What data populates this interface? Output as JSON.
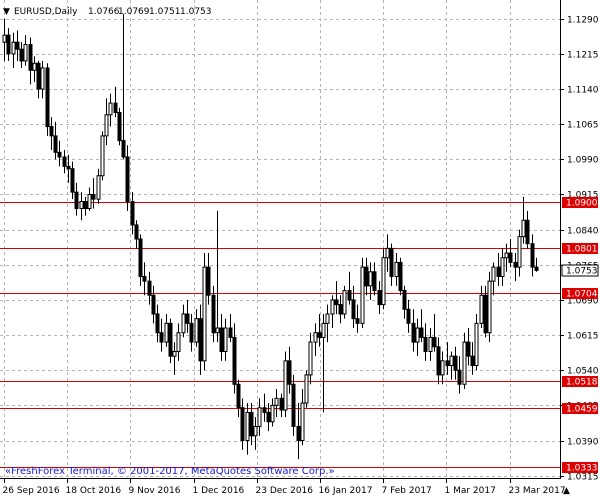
{
  "header": {
    "symbol_label": "EURUSD,Daily",
    "ohlc_values": [
      "1.0766",
      "1.0769",
      "1.0751",
      "1.0753"
    ]
  },
  "footer": {
    "copyright": "«FreshForex Terminal, © 2001-2017, MetaQuotes Software Corp.»"
  },
  "colors": {
    "background": "#ffffff",
    "grid": "#b4b4b4",
    "candle_line": "#000000",
    "bull_body": "#ffffff",
    "bear_body": "#000000",
    "level_line": "#dd0000",
    "level_label_bg": "#dd0000",
    "current_price_label_bg": "#ffffff",
    "copyright_text": "#1a1acc"
  },
  "chart_data": {
    "type": "candlestick",
    "title": "EURUSD,Daily",
    "y_axis_ticks": [
      "1.1290",
      "1.1215",
      "1.1140",
      "1.1065",
      "1.0990",
      "1.0915",
      "1.0840",
      "1.0765",
      "1.0690",
      "1.0615",
      "1.0540",
      "1.0465",
      "1.0390",
      "1.0315"
    ],
    "y_tick_values": [
      1.129,
      1.1215,
      1.114,
      1.1065,
      1.099,
      1.0915,
      1.084,
      1.0765,
      1.069,
      1.0615,
      1.054,
      1.0465,
      1.039,
      1.0315
    ],
    "x_axis_labels": [
      "26 Sep 2016",
      "18 Oct 2016",
      "9 Nov 2016",
      "1 Dec 2016",
      "23 Dec 2016",
      "16 Jan 2017",
      "7 Feb 2017",
      "1 Mar 2017",
      "23 Mar 2017"
    ],
    "ylim": [
      1.031,
      1.133
    ],
    "levels": [
      {
        "label": "1.0900",
        "value": 1.09
      },
      {
        "label": "1.0801",
        "value": 1.0801
      },
      {
        "label": "1.0704",
        "value": 1.0704
      },
      {
        "label": "1.0518",
        "value": 1.0518
      },
      {
        "label": "1.0459",
        "value": 1.0459
      },
      {
        "label": "1.0333",
        "value": 1.0333
      }
    ],
    "current_price": {
      "label": "1.0753",
      "value": 1.0753
    },
    "candles": [
      {
        "o": 1.124,
        "h": 1.129,
        "l": 1.12,
        "c": 1.1255
      },
      {
        "o": 1.1255,
        "h": 1.127,
        "l": 1.12,
        "c": 1.1215
      },
      {
        "o": 1.1215,
        "h": 1.126,
        "l": 1.1185,
        "c": 1.124
      },
      {
        "o": 1.124,
        "h": 1.1265,
        "l": 1.12,
        "c": 1.1225
      },
      {
        "o": 1.1225,
        "h": 1.124,
        "l": 1.1185,
        "c": 1.12
      },
      {
        "o": 1.12,
        "h": 1.1255,
        "l": 1.119,
        "c": 1.1235
      },
      {
        "o": 1.1235,
        "h": 1.125,
        "l": 1.115,
        "c": 1.118
      },
      {
        "o": 1.118,
        "h": 1.121,
        "l": 1.1155,
        "c": 1.1195
      },
      {
        "o": 1.1195,
        "h": 1.12,
        "l": 1.112,
        "c": 1.114
      },
      {
        "o": 1.114,
        "h": 1.12,
        "l": 1.112,
        "c": 1.1185
      },
      {
        "o": 1.1185,
        "h": 1.1195,
        "l": 1.104,
        "c": 1.106
      },
      {
        "o": 1.106,
        "h": 1.108,
        "l": 1.101,
        "c": 1.104
      },
      {
        "o": 1.104,
        "h": 1.107,
        "l": 1.099,
        "c": 1.1005
      },
      {
        "o": 1.1005,
        "h": 1.103,
        "l": 1.0975,
        "c": 1.0995
      },
      {
        "o": 1.0995,
        "h": 1.101,
        "l": 1.096,
        "c": 1.0975
      },
      {
        "o": 1.0975,
        "h": 1.1,
        "l": 1.094,
        "c": 1.097
      },
      {
        "o": 1.097,
        "h": 1.0985,
        "l": 1.0905,
        "c": 1.092
      },
      {
        "o": 1.092,
        "h": 1.094,
        "l": 1.087,
        "c": 1.0885
      },
      {
        "o": 1.0885,
        "h": 1.092,
        "l": 1.086,
        "c": 1.09
      },
      {
        "o": 1.09,
        "h": 1.091,
        "l": 1.087,
        "c": 1.0885
      },
      {
        "o": 1.0885,
        "h": 1.093,
        "l": 1.088,
        "c": 1.0915
      },
      {
        "o": 1.0915,
        "h": 1.095,
        "l": 1.0885,
        "c": 1.0905
      },
      {
        "o": 1.0905,
        "h": 1.097,
        "l": 1.0895,
        "c": 1.0955
      },
      {
        "o": 1.0955,
        "h": 1.105,
        "l": 1.0945,
        "c": 1.104
      },
      {
        "o": 1.104,
        "h": 1.112,
        "l": 1.102,
        "c": 1.1085
      },
      {
        "o": 1.1085,
        "h": 1.113,
        "l": 1.106,
        "c": 1.111
      },
      {
        "o": 1.111,
        "h": 1.1145,
        "l": 1.108,
        "c": 1.109
      },
      {
        "o": 1.109,
        "h": 1.11,
        "l": 1.102,
        "c": 1.103
      },
      {
        "o": 1.103,
        "h": 1.13,
        "l": 1.099,
        "c": 1.0995
      },
      {
        "o": 1.0995,
        "h": 1.102,
        "l": 1.088,
        "c": 1.09
      },
      {
        "o": 1.09,
        "h": 1.092,
        "l": 1.083,
        "c": 1.085
      },
      {
        "o": 1.085,
        "h": 1.086,
        "l": 1.08,
        "c": 1.082
      },
      {
        "o": 1.082,
        "h": 1.083,
        "l": 1.072,
        "c": 1.074
      },
      {
        "o": 1.074,
        "h": 1.077,
        "l": 1.07,
        "c": 1.073
      },
      {
        "o": 1.073,
        "h": 1.075,
        "l": 1.068,
        "c": 1.07
      },
      {
        "o": 1.07,
        "h": 1.072,
        "l": 1.064,
        "c": 1.066
      },
      {
        "o": 1.066,
        "h": 1.068,
        "l": 1.06,
        "c": 1.062
      },
      {
        "o": 1.062,
        "h": 1.065,
        "l": 1.058,
        "c": 1.06
      },
      {
        "o": 1.06,
        "h": 1.066,
        "l": 1.059,
        "c": 1.064
      },
      {
        "o": 1.064,
        "h": 1.065,
        "l": 1.0555,
        "c": 1.057
      },
      {
        "o": 1.057,
        "h": 1.06,
        "l": 1.053,
        "c": 1.058
      },
      {
        "o": 1.058,
        "h": 1.064,
        "l": 1.056,
        "c": 1.062
      },
      {
        "o": 1.062,
        "h": 1.068,
        "l": 1.061,
        "c": 1.066
      },
      {
        "o": 1.066,
        "h": 1.069,
        "l": 1.062,
        "c": 1.064
      },
      {
        "o": 1.064,
        "h": 1.066,
        "l": 1.058,
        "c": 1.06
      },
      {
        "o": 1.06,
        "h": 1.067,
        "l": 1.059,
        "c": 1.065
      },
      {
        "o": 1.065,
        "h": 1.068,
        "l": 1.053,
        "c": 1.056
      },
      {
        "o": 1.056,
        "h": 1.079,
        "l": 1.054,
        "c": 1.076
      },
      {
        "o": 1.076,
        "h": 1.079,
        "l": 1.068,
        "c": 1.07
      },
      {
        "o": 1.07,
        "h": 1.072,
        "l": 1.06,
        "c": 1.062
      },
      {
        "o": 1.062,
        "h": 1.088,
        "l": 1.06,
        "c": 1.063
      },
      {
        "o": 1.063,
        "h": 1.066,
        "l": 1.056,
        "c": 1.058
      },
      {
        "o": 1.058,
        "h": 1.065,
        "l": 1.056,
        "c": 1.063
      },
      {
        "o": 1.063,
        "h": 1.066,
        "l": 1.06,
        "c": 1.061
      },
      {
        "o": 1.061,
        "h": 1.064,
        "l": 1.049,
        "c": 1.051
      },
      {
        "o": 1.051,
        "h": 1.052,
        "l": 1.044,
        "c": 1.046
      },
      {
        "o": 1.046,
        "h": 1.048,
        "l": 1.037,
        "c": 1.039
      },
      {
        "o": 1.039,
        "h": 1.047,
        "l": 1.036,
        "c": 1.045
      },
      {
        "o": 1.045,
        "h": 1.047,
        "l": 1.038,
        "c": 1.04
      },
      {
        "o": 1.04,
        "h": 1.044,
        "l": 1.037,
        "c": 1.042
      },
      {
        "o": 1.042,
        "h": 1.048,
        "l": 1.04,
        "c": 1.046
      },
      {
        "o": 1.046,
        "h": 1.049,
        "l": 1.043,
        "c": 1.045
      },
      {
        "o": 1.045,
        "h": 1.047,
        "l": 1.041,
        "c": 1.043
      },
      {
        "o": 1.043,
        "h": 1.048,
        "l": 1.042,
        "c": 1.0465
      },
      {
        "o": 1.0465,
        "h": 1.05,
        "l": 1.044,
        "c": 1.048
      },
      {
        "o": 1.048,
        "h": 1.049,
        "l": 1.044,
        "c": 1.0455
      },
      {
        "o": 1.0455,
        "h": 1.058,
        "l": 1.044,
        "c": 1.056
      },
      {
        "o": 1.056,
        "h": 1.059,
        "l": 1.049,
        "c": 1.051
      },
      {
        "o": 1.051,
        "h": 1.053,
        "l": 1.04,
        "c": 1.042
      },
      {
        "o": 1.042,
        "h": 1.047,
        "l": 1.035,
        "c": 1.039
      },
      {
        "o": 1.039,
        "h": 1.05,
        "l": 1.038,
        "c": 1.047
      },
      {
        "o": 1.047,
        "h": 1.054,
        "l": 1.046,
        "c": 1.053
      },
      {
        "o": 1.053,
        "h": 1.062,
        "l": 1.051,
        "c": 1.06
      },
      {
        "o": 1.06,
        "h": 1.064,
        "l": 1.057,
        "c": 1.062
      },
      {
        "o": 1.062,
        "h": 1.066,
        "l": 1.059,
        "c": 1.061
      },
      {
        "o": 1.061,
        "h": 1.066,
        "l": 1.045,
        "c": 1.064
      },
      {
        "o": 1.064,
        "h": 1.068,
        "l": 1.06,
        "c": 1.066
      },
      {
        "o": 1.066,
        "h": 1.07,
        "l": 1.063,
        "c": 1.069
      },
      {
        "o": 1.069,
        "h": 1.073,
        "l": 1.066,
        "c": 1.068
      },
      {
        "o": 1.068,
        "h": 1.07,
        "l": 1.064,
        "c": 1.066
      },
      {
        "o": 1.066,
        "h": 1.072,
        "l": 1.065,
        "c": 1.071
      },
      {
        "o": 1.071,
        "h": 1.075,
        "l": 1.068,
        "c": 1.069
      },
      {
        "o": 1.069,
        "h": 1.072,
        "l": 1.063,
        "c": 1.065
      },
      {
        "o": 1.065,
        "h": 1.068,
        "l": 1.062,
        "c": 1.064
      },
      {
        "o": 1.064,
        "h": 1.078,
        "l": 1.063,
        "c": 1.076
      },
      {
        "o": 1.076,
        "h": 1.078,
        "l": 1.07,
        "c": 1.072
      },
      {
        "o": 1.072,
        "h": 1.077,
        "l": 1.069,
        "c": 1.075
      },
      {
        "o": 1.075,
        "h": 1.077,
        "l": 1.07,
        "c": 1.071
      },
      {
        "o": 1.071,
        "h": 1.073,
        "l": 1.066,
        "c": 1.068
      },
      {
        "o": 1.068,
        "h": 1.08,
        "l": 1.067,
        "c": 1.078
      },
      {
        "o": 1.078,
        "h": 1.083,
        "l": 1.075,
        "c": 1.08
      },
      {
        "o": 1.08,
        "h": 1.081,
        "l": 1.072,
        "c": 1.074
      },
      {
        "o": 1.074,
        "h": 1.079,
        "l": 1.072,
        "c": 1.077
      },
      {
        "o": 1.077,
        "h": 1.078,
        "l": 1.07,
        "c": 1.071
      },
      {
        "o": 1.071,
        "h": 1.072,
        "l": 1.065,
        "c": 1.067
      },
      {
        "o": 1.067,
        "h": 1.069,
        "l": 1.062,
        "c": 1.064
      },
      {
        "o": 1.064,
        "h": 1.067,
        "l": 1.058,
        "c": 1.06
      },
      {
        "o": 1.06,
        "h": 1.065,
        "l": 1.057,
        "c": 1.063
      },
      {
        "o": 1.063,
        "h": 1.067,
        "l": 1.06,
        "c": 1.061
      },
      {
        "o": 1.061,
        "h": 1.064,
        "l": 1.056,
        "c": 1.058
      },
      {
        "o": 1.058,
        "h": 1.063,
        "l": 1.056,
        "c": 1.061
      },
      {
        "o": 1.061,
        "h": 1.066,
        "l": 1.058,
        "c": 1.059
      },
      {
        "o": 1.059,
        "h": 1.061,
        "l": 1.051,
        "c": 1.053
      },
      {
        "o": 1.053,
        "h": 1.058,
        "l": 1.051,
        "c": 1.056
      },
      {
        "o": 1.056,
        "h": 1.06,
        "l": 1.053,
        "c": 1.055
      },
      {
        "o": 1.055,
        "h": 1.058,
        "l": 1.052,
        "c": 1.057
      },
      {
        "o": 1.057,
        "h": 1.059,
        "l": 1.052,
        "c": 1.054
      },
      {
        "o": 1.054,
        "h": 1.057,
        "l": 1.049,
        "c": 1.051
      },
      {
        "o": 1.051,
        "h": 1.062,
        "l": 1.05,
        "c": 1.06
      },
      {
        "o": 1.06,
        "h": 1.063,
        "l": 1.055,
        "c": 1.057
      },
      {
        "o": 1.057,
        "h": 1.06,
        "l": 1.053,
        "c": 1.055
      },
      {
        "o": 1.055,
        "h": 1.066,
        "l": 1.054,
        "c": 1.064
      },
      {
        "o": 1.064,
        "h": 1.072,
        "l": 1.063,
        "c": 1.07
      },
      {
        "o": 1.07,
        "h": 1.072,
        "l": 1.061,
        "c": 1.062
      },
      {
        "o": 1.062,
        "h": 1.075,
        "l": 1.06,
        "c": 1.073
      },
      {
        "o": 1.073,
        "h": 1.077,
        "l": 1.07,
        "c": 1.076
      },
      {
        "o": 1.076,
        "h": 1.079,
        "l": 1.072,
        "c": 1.074
      },
      {
        "o": 1.074,
        "h": 1.08,
        "l": 1.072,
        "c": 1.078
      },
      {
        "o": 1.078,
        "h": 1.081,
        "l": 1.075,
        "c": 1.079
      },
      {
        "o": 1.079,
        "h": 1.082,
        "l": 1.076,
        "c": 1.077
      },
      {
        "o": 1.077,
        "h": 1.079,
        "l": 1.073,
        "c": 1.076
      },
      {
        "o": 1.076,
        "h": 1.084,
        "l": 1.074,
        "c": 1.0825
      },
      {
        "o": 1.0825,
        "h": 1.091,
        "l": 1.081,
        "c": 1.086
      },
      {
        "o": 1.086,
        "h": 1.088,
        "l": 1.08,
        "c": 1.081
      },
      {
        "o": 1.081,
        "h": 1.083,
        "l": 1.074,
        "c": 1.076
      },
      {
        "o": 1.076,
        "h": 1.078,
        "l": 1.075,
        "c": 1.0753
      }
    ]
  }
}
